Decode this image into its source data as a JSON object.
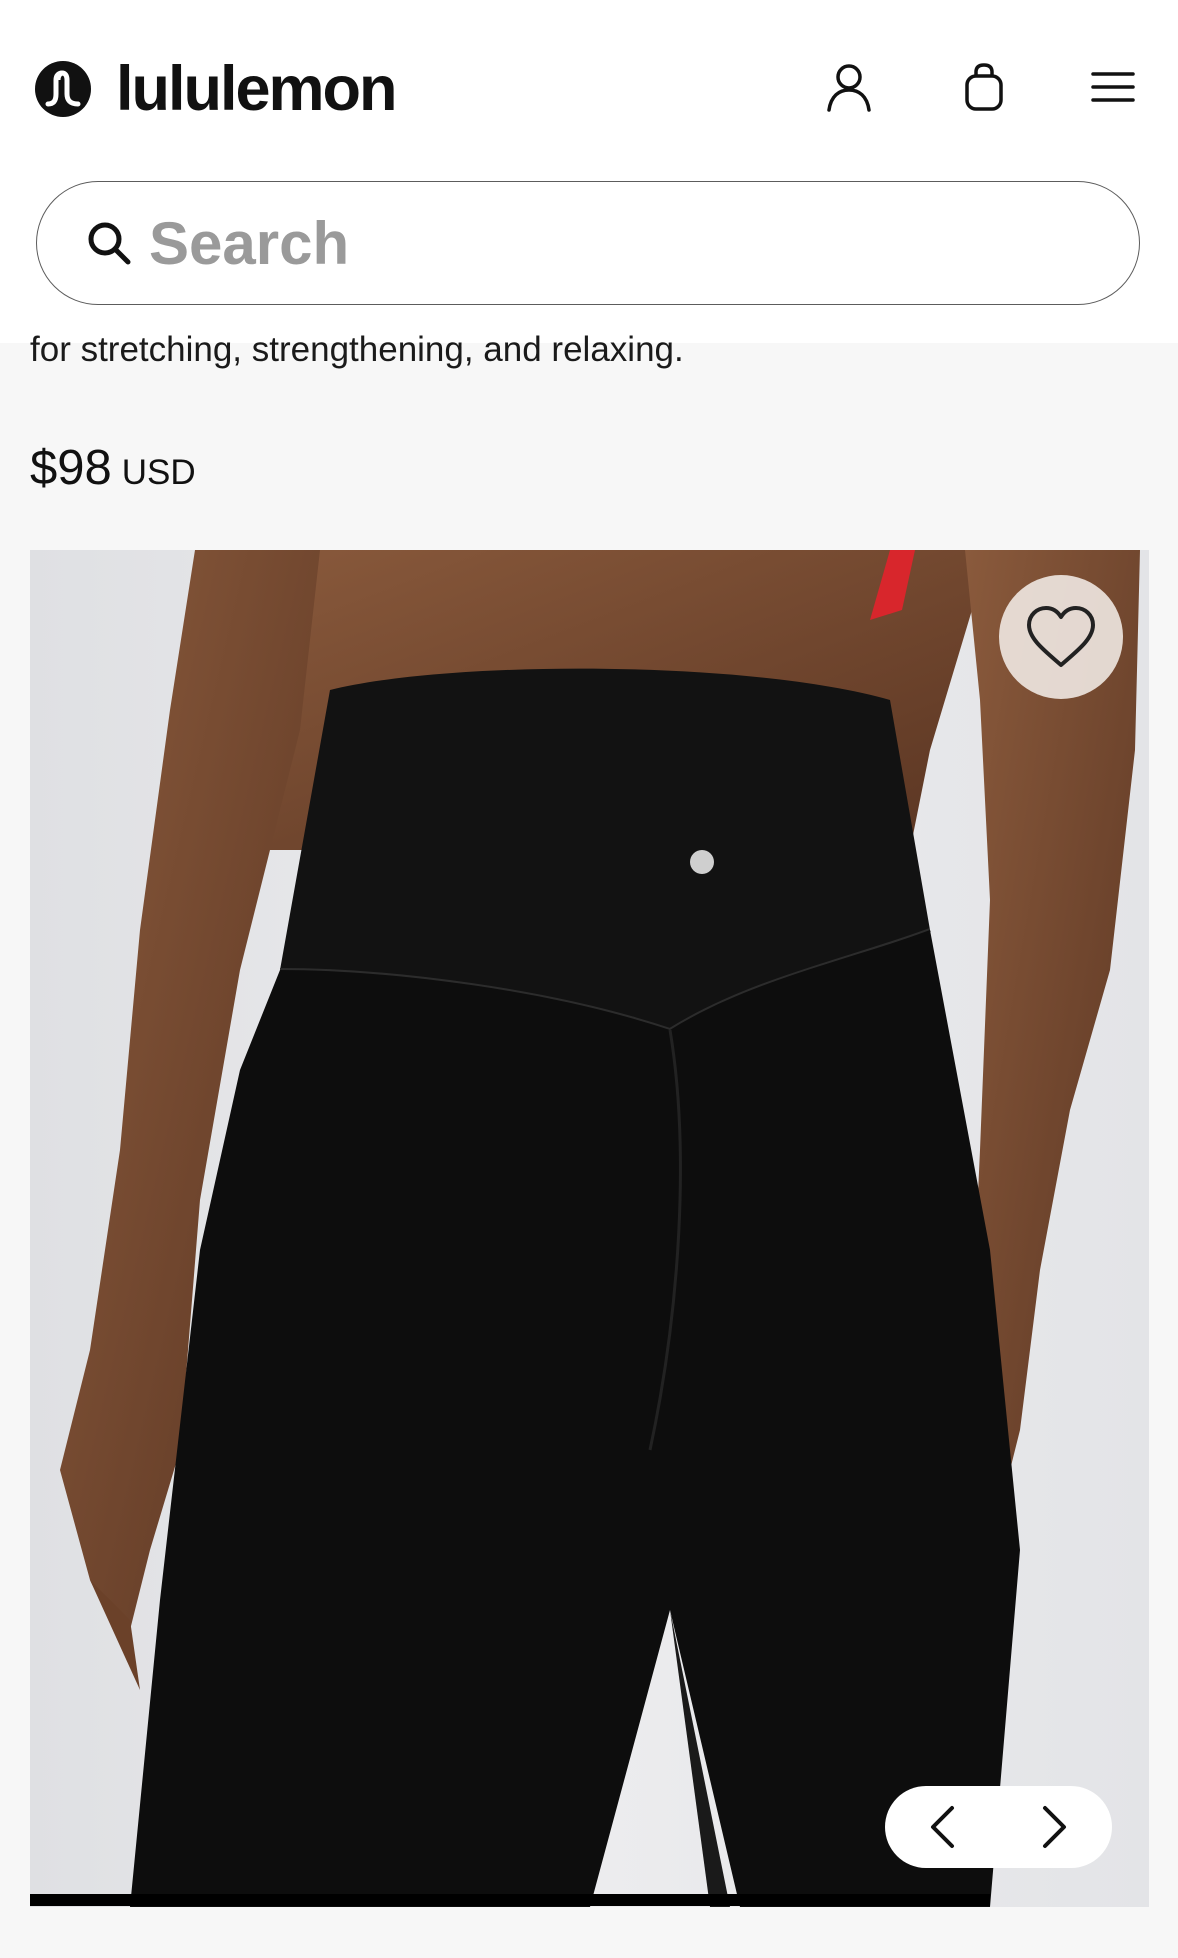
{
  "header": {
    "brand": "lululemon",
    "icons": [
      "account-icon",
      "shopping-bag-icon",
      "menu-icon"
    ]
  },
  "search": {
    "placeholder": "Search"
  },
  "product": {
    "description_fragment": "for stretching, strengthening, and relaxing.",
    "price_amount": "$98",
    "price_currency": "USD"
  },
  "gallery": {
    "wishlist_icon": "heart-icon",
    "prev_icon": "chevron-left-icon",
    "next_icon": "chevron-right-icon",
    "progress_fraction": 0.858
  },
  "colors": {
    "brand": "#111111",
    "page_background": "#f7f7f7",
    "search_placeholder": "#9a9a9a"
  }
}
